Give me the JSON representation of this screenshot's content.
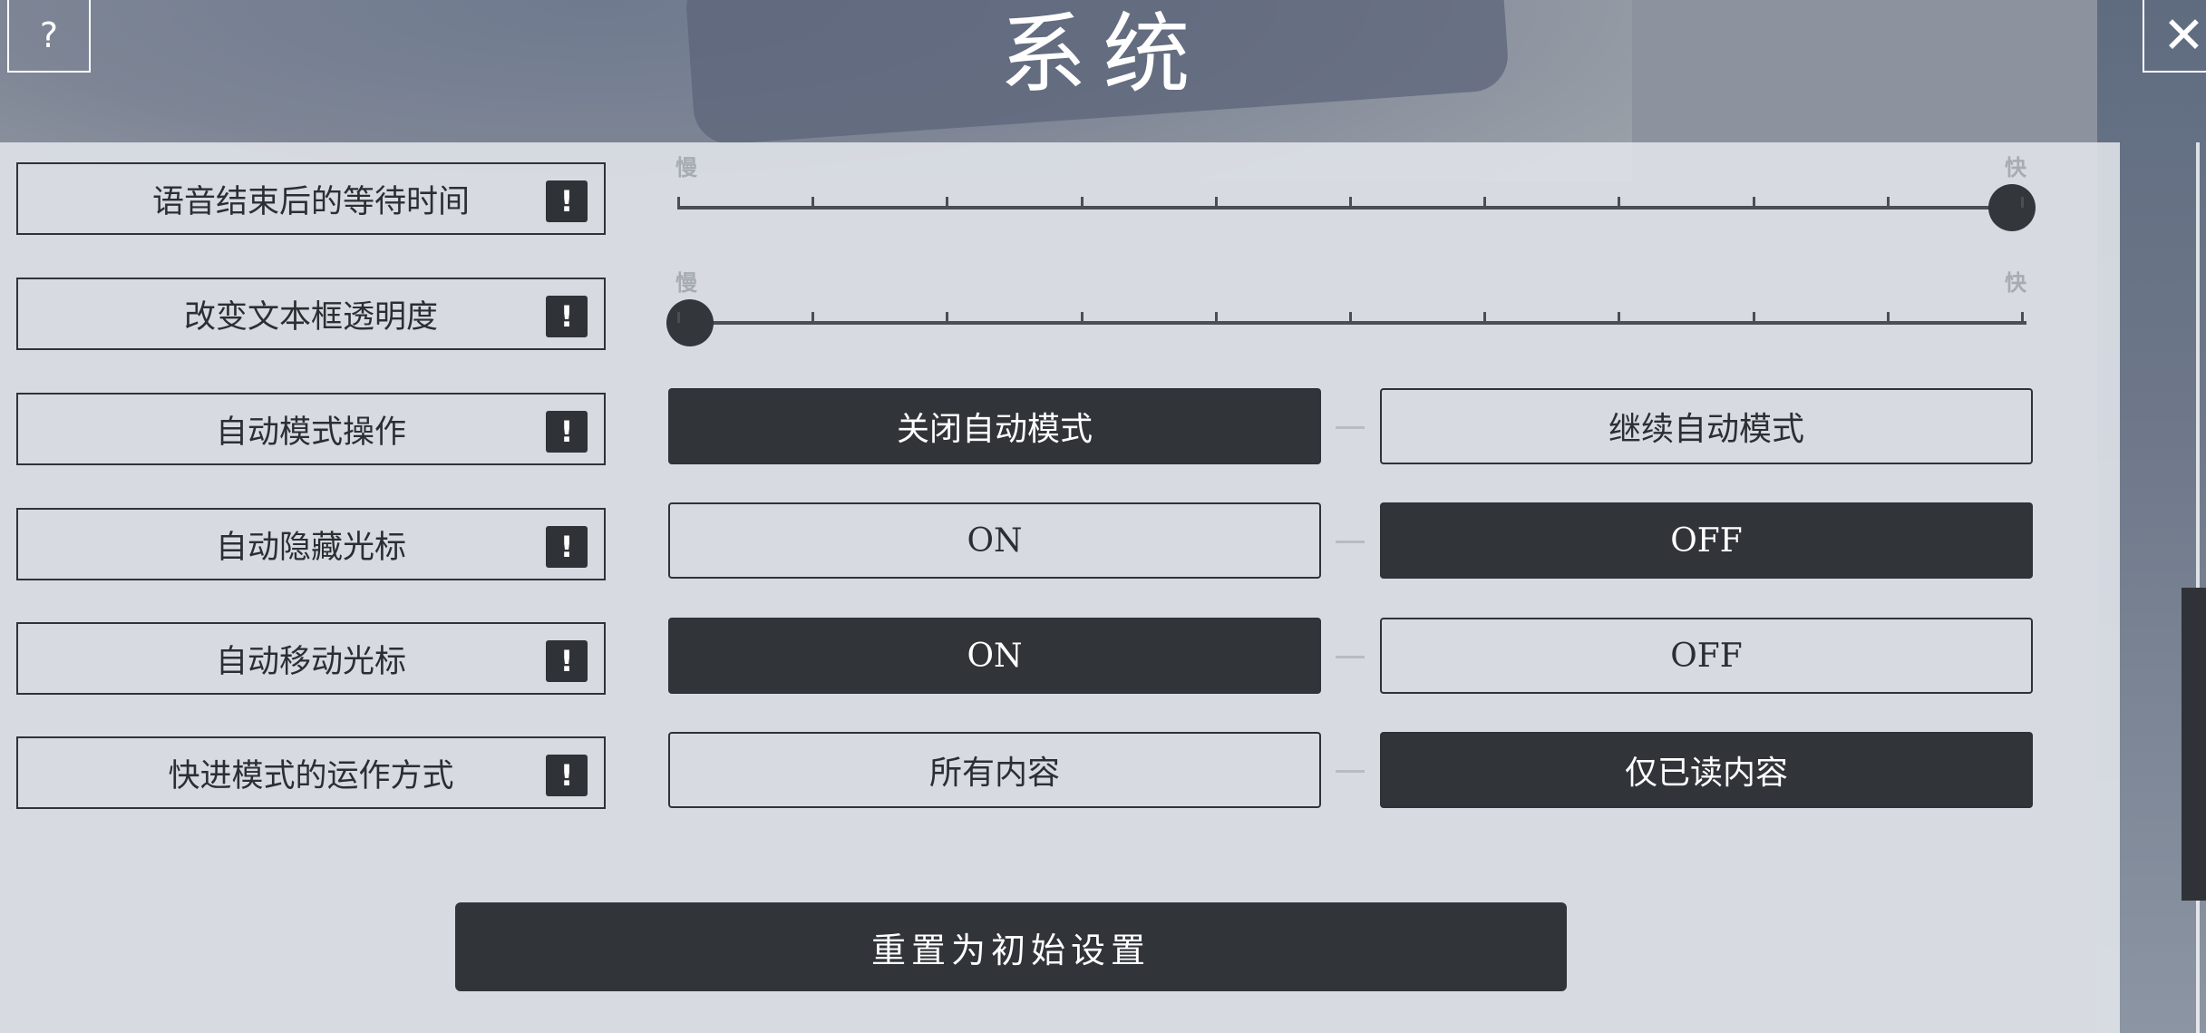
{
  "window": {
    "title": "系统",
    "help_glyph": "?",
    "close_glyph": "✕"
  },
  "settings": [
    {
      "label": "语音结束后的等待时间",
      "type": "slider",
      "min_label": "慢",
      "max_label": "快",
      "value": 1.0
    },
    {
      "label": "改变文本框透明度",
      "type": "slider",
      "min_label": "慢",
      "max_label": "快",
      "value": 0.0
    },
    {
      "label": "自动模式操作",
      "type": "toggle",
      "options": [
        "关闭自动模式",
        "继续自动模式"
      ],
      "selected": 0
    },
    {
      "label": "自动隐藏光标",
      "type": "toggle",
      "options": [
        "ON",
        "OFF"
      ],
      "selected": 1
    },
    {
      "label": "自动移动光标",
      "type": "toggle",
      "options": [
        "ON",
        "OFF"
      ],
      "selected": 0
    },
    {
      "label": "快进模式的运作方式",
      "type": "toggle",
      "options": [
        "所有内容",
        "仅已读内容"
      ],
      "selected": 1
    }
  ],
  "info_glyph": "!",
  "reset_label": "重置为初始设置",
  "icons": {
    "help": "help-icon",
    "close": "close-icon",
    "info": "info-icon"
  },
  "colors": {
    "dark": "#313539",
    "panel": "#e1e5ea"
  }
}
